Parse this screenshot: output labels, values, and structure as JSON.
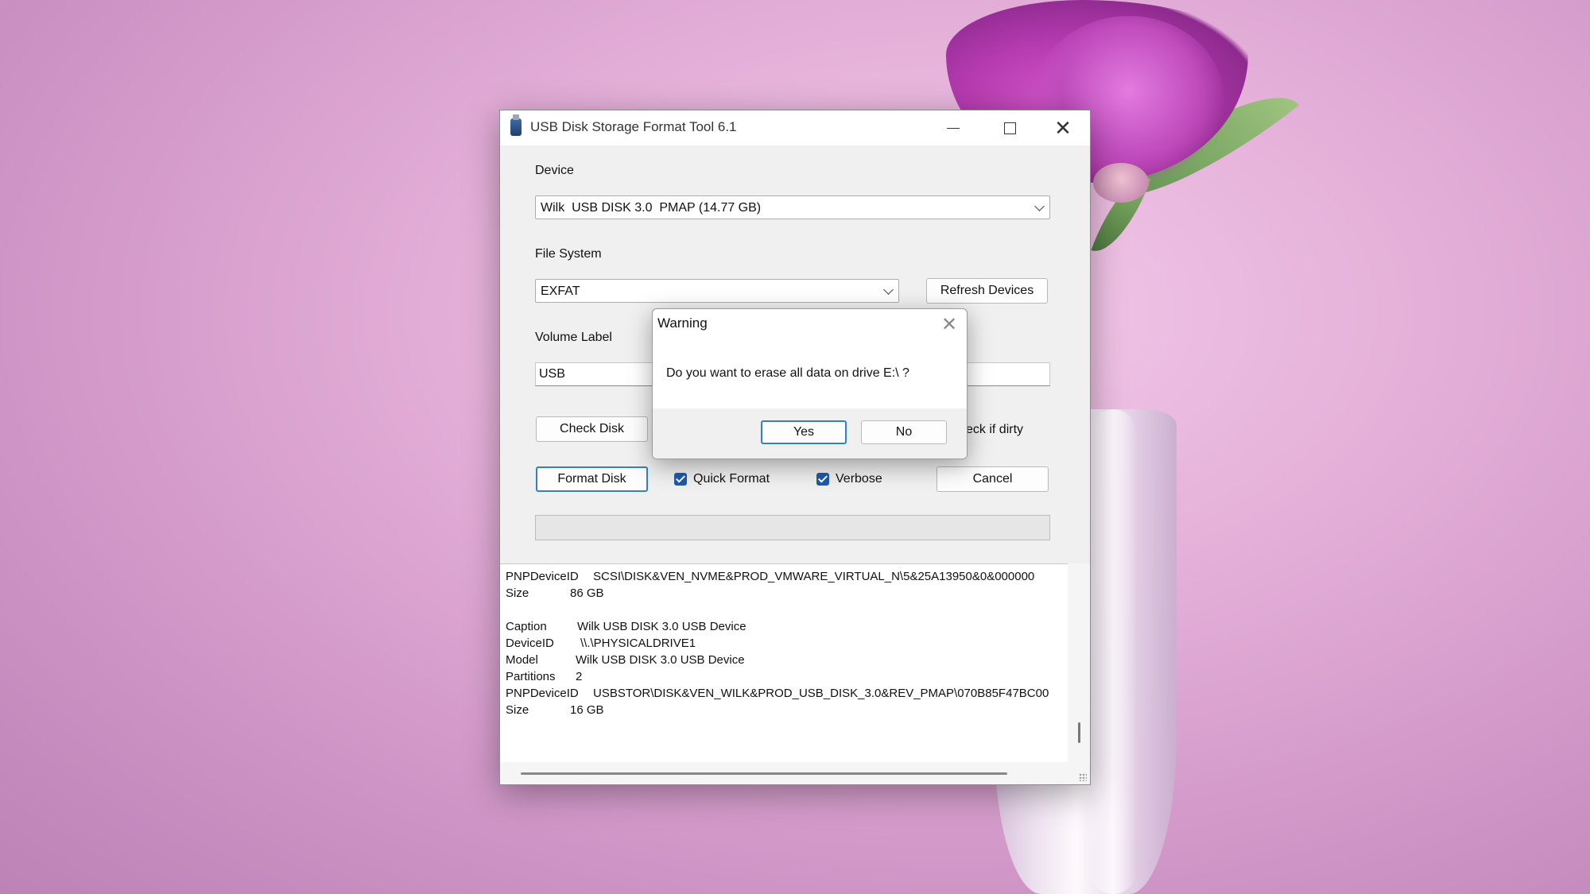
{
  "window": {
    "title": "USB Disk Storage Format Tool 6.1",
    "controls": {
      "minimize": "minimize",
      "maximize": "maximize",
      "close": "close"
    }
  },
  "device": {
    "label": "Device",
    "selected": "Wilk  USB DISK 3.0  PMAP (14.77 GB)"
  },
  "file_system": {
    "label": "File System",
    "selected": "EXFAT",
    "refresh_button": "Refresh Devices"
  },
  "volume_label": {
    "label": "Volume Label",
    "value": "USB"
  },
  "actions": {
    "check_disk": "Check Disk",
    "check_if_dirty": "eck if dirty",
    "format_disk": "Format Disk",
    "quick_format": "Quick Format",
    "quick_format_checked": true,
    "verbose": "Verbose",
    "verbose_checked": true,
    "cancel": "Cancel"
  },
  "progress": {
    "percent": 0
  },
  "log": [
    {
      "key": "PNPDeviceID",
      "value": "SCSI\\DISK&VEN_NVME&PROD_VMWARE_VIRTUAL_N\\5&25A13950&0&000000"
    },
    {
      "key": "Size",
      "value": "86 GB"
    },
    {
      "key": "",
      "value": ""
    },
    {
      "key": "Caption",
      "value": "Wilk USB DISK 3.0 USB Device"
    },
    {
      "key": "DeviceID",
      "value": "\\\\.\\PHYSICALDRIVE1"
    },
    {
      "key": "Model",
      "value": "Wilk USB DISK 3.0 USB Device"
    },
    {
      "key": "Partitions",
      "value": "2"
    },
    {
      "key": "PNPDeviceID",
      "value": "USBSTOR\\DISK&VEN_WILK&PROD_USB_DISK_3.0&REV_PMAP\\070B85F47BC00"
    },
    {
      "key": "Size",
      "value": "16 GB"
    }
  ],
  "dialog": {
    "title": "Warning",
    "message": "Do you want to erase all data on drive E:\\ ?",
    "yes": "Yes",
    "no": "No"
  },
  "icons": {
    "app": "usb-drive-icon",
    "dropdown": "chevron-down-icon",
    "close": "close-icon"
  }
}
